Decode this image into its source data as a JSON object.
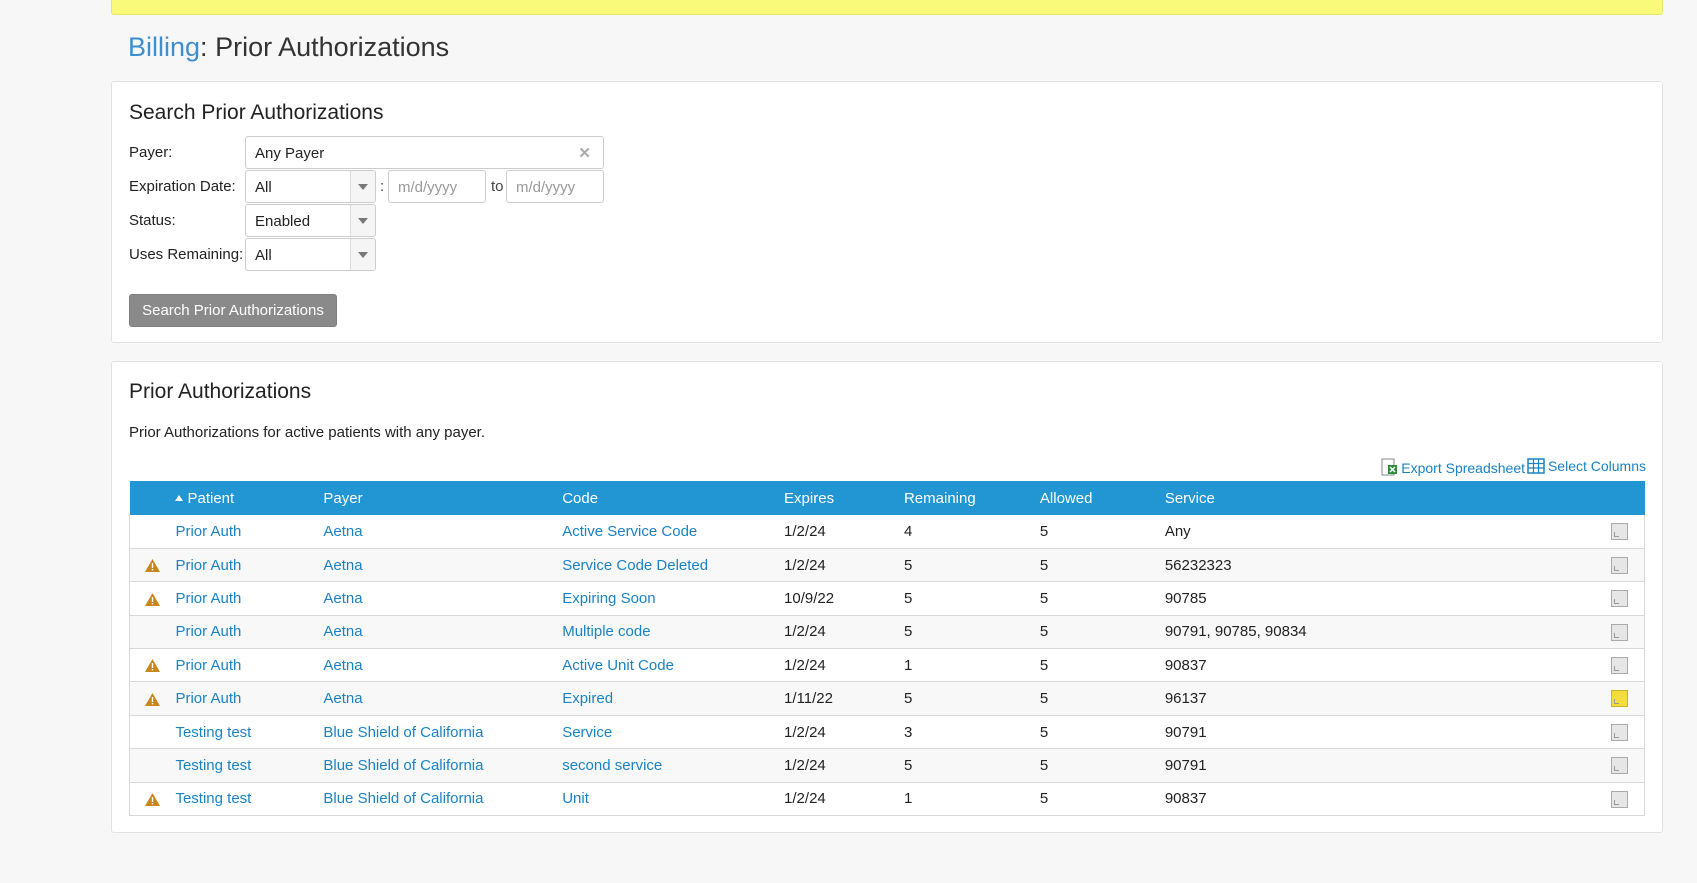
{
  "header": {
    "breadcrumb": "Billing",
    "separator": ":",
    "title": " Prior Authorizations"
  },
  "search": {
    "title": "Search Prior Authorizations",
    "payer_label": "Payer:",
    "payer_value": "Any Payer",
    "expiration_label": "Expiration Date:",
    "expiration_value": "All",
    "date_from_placeholder": "m/d/yyyy",
    "range_colon": ":",
    "range_to": "to",
    "date_to_placeholder": "m/d/yyyy",
    "status_label": "Status:",
    "status_value": "Enabled",
    "uses_label": "Uses Remaining:",
    "uses_value": "All",
    "button_label": "Search Prior Authorizations"
  },
  "results": {
    "title": "Prior Authorizations",
    "description": "Prior Authorizations for active patients with any payer.",
    "export_label": "Export Spreadsheet",
    "select_columns_label": "Select Columns",
    "columns": [
      "Patient",
      "Payer",
      "Code",
      "Expires",
      "Remaining",
      "Allowed",
      "Service"
    ],
    "sort_column": "Patient",
    "rows": [
      {
        "warning": false,
        "patient": "Prior Auth",
        "payer": "Aetna",
        "code": "Active Service Code",
        "expires": "1/2/24",
        "remaining": "4",
        "allowed": "5",
        "service": "Any",
        "note": false
      },
      {
        "warning": true,
        "patient": "Prior Auth",
        "payer": "Aetna",
        "code": "Service Code Deleted",
        "expires": "1/2/24",
        "remaining": "5",
        "allowed": "5",
        "service": "56232323",
        "note": false
      },
      {
        "warning": true,
        "patient": "Prior Auth",
        "payer": "Aetna",
        "code": "Expiring Soon",
        "expires": "10/9/22",
        "remaining": "5",
        "allowed": "5",
        "service": "90785",
        "note": false
      },
      {
        "warning": false,
        "patient": "Prior Auth",
        "payer": "Aetna",
        "code": "Multiple code",
        "expires": "1/2/24",
        "remaining": "5",
        "allowed": "5",
        "service": "90791, 90785, 90834",
        "note": false
      },
      {
        "warning": true,
        "patient": "Prior Auth",
        "payer": "Aetna",
        "code": "Active Unit Code",
        "expires": "1/2/24",
        "remaining": "1",
        "allowed": "5",
        "service": "90837",
        "note": false
      },
      {
        "warning": true,
        "patient": "Prior Auth",
        "payer": "Aetna",
        "code": "Expired",
        "expires": "1/11/22",
        "remaining": "5",
        "allowed": "5",
        "service": "96137",
        "note": true
      },
      {
        "warning": false,
        "patient": "Testing test",
        "payer": "Blue Shield of California",
        "code": "Service",
        "expires": "1/2/24",
        "remaining": "3",
        "allowed": "5",
        "service": "90791",
        "note": false
      },
      {
        "warning": false,
        "patient": "Testing test",
        "payer": "Blue Shield of California",
        "code": "second service",
        "expires": "1/2/24",
        "remaining": "5",
        "allowed": "5",
        "service": "90791",
        "note": false
      },
      {
        "warning": true,
        "patient": "Testing test",
        "payer": "Blue Shield of California",
        "code": "Unit",
        "expires": "1/2/24",
        "remaining": "1",
        "allowed": "5",
        "service": "90837",
        "note": false
      }
    ]
  },
  "colors": {
    "notice_bar": "#fafa7a",
    "table_header": "#2196d3",
    "link": "#1a83c6",
    "breadcrumb": "#3e8ed0",
    "warning": "#c9861a",
    "note_filled": "#f2dd3c"
  },
  "icons": {
    "warning": "warning-triangle-icon",
    "note": "note-icon",
    "export": "spreadsheet-icon",
    "columns": "table-columns-icon",
    "clear": "clear-x-icon",
    "dropdown": "chevron-down-icon"
  }
}
